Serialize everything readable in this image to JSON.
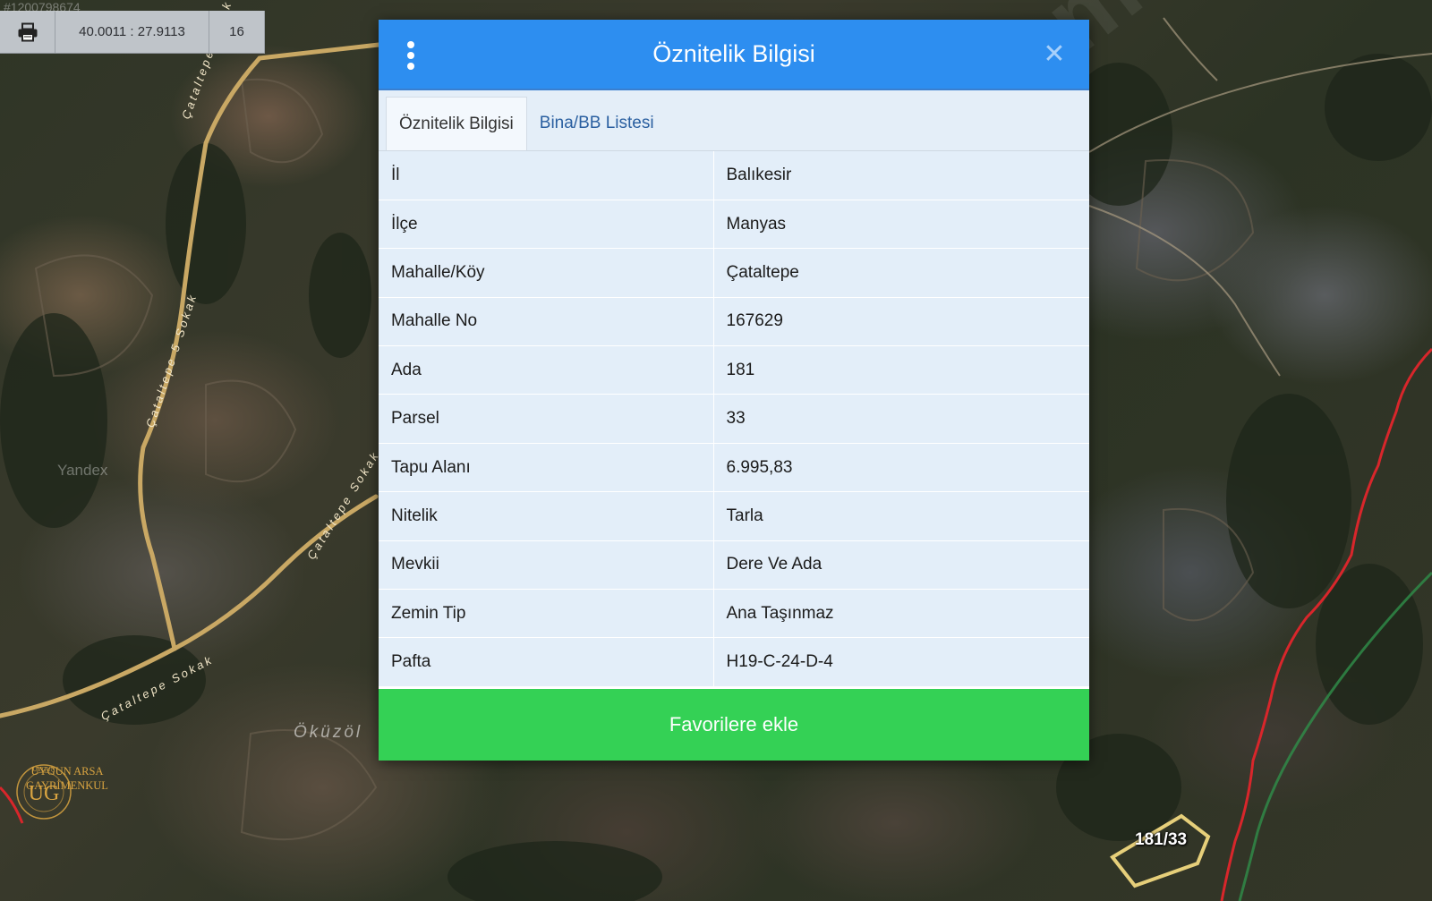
{
  "toolbar": {
    "print_icon": "printer-icon",
    "coordinates": "40.0011 : 27.9113",
    "zoom": "16",
    "listing_id": "#1200798674"
  },
  "map": {
    "road_labels": [
      "Çataltepe Sokak",
      "Çataltepe 5 Sokak",
      "Çataltepe Sokak",
      "Çataltepe Sokak"
    ],
    "place_label": "Öküzöl",
    "provider_label": "Yandex",
    "parcel_label": "181/33",
    "watermark": "sahibinden.com",
    "logo": {
      "monogram": "UG",
      "arc_text": "UYGUN",
      "line1": "UYGUN ARSA",
      "line2": "GAYRİMENKUL"
    }
  },
  "dialog": {
    "title": "Öznitelik Bilgisi",
    "menu_icon": "vertical-dots-icon",
    "close_icon": "close-icon",
    "tabs": [
      {
        "label": "Öznitelik Bilgisi",
        "active": true
      },
      {
        "label": "Bina/BB Listesi",
        "active": false
      }
    ],
    "rows": [
      {
        "key": "İl",
        "value": "Balıkesir"
      },
      {
        "key": "İlçe",
        "value": "Manyas"
      },
      {
        "key": "Mahalle/Köy",
        "value": "Çataltepe"
      },
      {
        "key": "Mahalle No",
        "value": "167629"
      },
      {
        "key": "Ada",
        "value": "181"
      },
      {
        "key": "Parsel",
        "value": "33"
      },
      {
        "key": "Tapu Alanı",
        "value": "6.995,83"
      },
      {
        "key": "Nitelik",
        "value": "Tarla"
      },
      {
        "key": "Mevkii",
        "value": "Dere Ve Ada"
      },
      {
        "key": "Zemin Tip",
        "value": "Ana Taşınmaz"
      },
      {
        "key": "Pafta",
        "value": "H19-C-24-D-4"
      }
    ],
    "favorite_button": "Favorilere ekle"
  },
  "colors": {
    "header_blue": "#2d8ef0",
    "row_bg": "#e3eef9",
    "button_green": "#34d155",
    "road": "#c9a864",
    "boundary_red": "#d8262b"
  }
}
